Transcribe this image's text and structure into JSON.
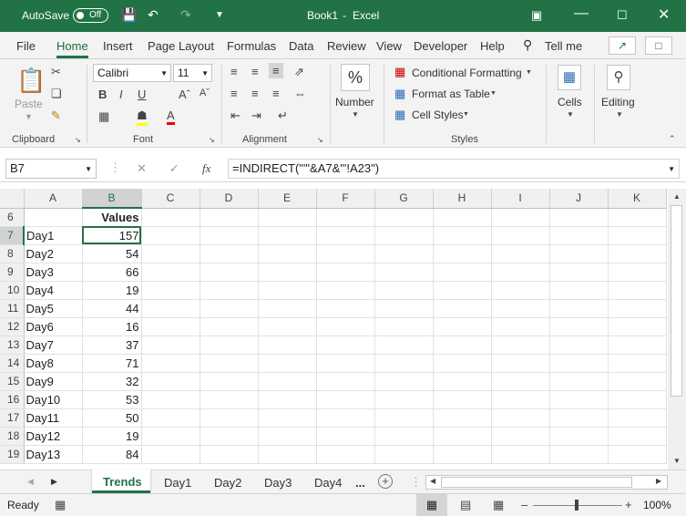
{
  "title": {
    "autosave": "AutoSave",
    "toggle": "Off",
    "doc": "Book1",
    "sep": "-",
    "app": "Excel"
  },
  "tabs": [
    "File",
    "Home",
    "Insert",
    "Page Layout",
    "Formulas",
    "Data",
    "Review",
    "View",
    "Developer",
    "Help",
    "Tell me"
  ],
  "ribbon": {
    "paste": "Paste",
    "clipboard": "Clipboard",
    "font_name": "Calibri",
    "font_size": "11",
    "font": "Font",
    "alignment": "Alignment",
    "number": "Number",
    "cond_fmt": "Conditional Formatting",
    "fmt_table": "Format as Table",
    "cell_styles": "Cell Styles",
    "styles": "Styles",
    "cells": "Cells",
    "editing": "Editing"
  },
  "formula_bar": {
    "name_box": "B7",
    "formula": "=INDIRECT(\"'\"&A7&\"'!A23\")",
    "fx": "fx"
  },
  "columns": [
    "A",
    "B",
    "C",
    "D",
    "E",
    "F",
    "G",
    "H",
    "I",
    "J",
    "K"
  ],
  "header_row": {
    "row": "6",
    "b": "Values"
  },
  "rows": [
    {
      "row": "7",
      "a": "Day1",
      "b": "157"
    },
    {
      "row": "8",
      "a": "Day2",
      "b": "54"
    },
    {
      "row": "9",
      "a": "Day3",
      "b": "66"
    },
    {
      "row": "10",
      "a": "Day4",
      "b": "19"
    },
    {
      "row": "11",
      "a": "Day5",
      "b": "44"
    },
    {
      "row": "12",
      "a": "Day6",
      "b": "16"
    },
    {
      "row": "13",
      "a": "Day7",
      "b": "37"
    },
    {
      "row": "14",
      "a": "Day8",
      "b": "71"
    },
    {
      "row": "15",
      "a": "Day9",
      "b": "32"
    },
    {
      "row": "16",
      "a": "Day10",
      "b": "53"
    },
    {
      "row": "17",
      "a": "Day11",
      "b": "50"
    },
    {
      "row": "18",
      "a": "Day12",
      "b": "19"
    },
    {
      "row": "19",
      "a": "Day13",
      "b": "84"
    }
  ],
  "sheets": [
    "Trends",
    "Day1",
    "Day2",
    "Day3",
    "Day4",
    "..."
  ],
  "status": {
    "ready": "Ready",
    "zoom": "100%"
  },
  "colors": {
    "accent": "#217346"
  }
}
